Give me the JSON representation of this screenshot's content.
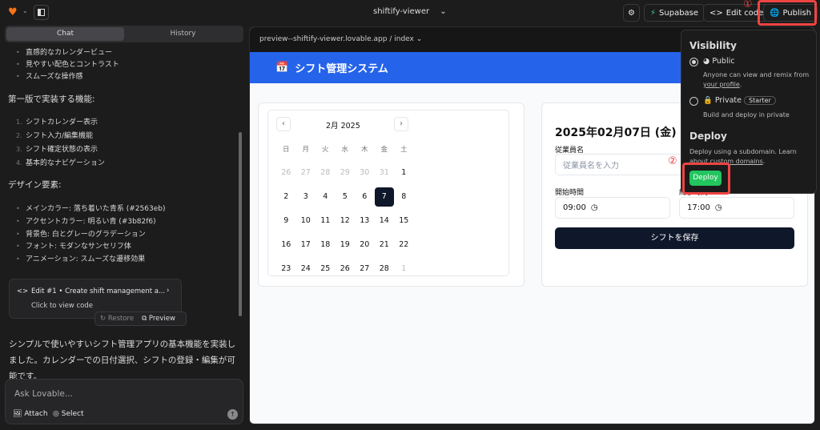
{
  "topbar": {
    "project": "shiftify-viewer",
    "supabase": "Supabase",
    "edit_code": "Edit code",
    "publish": "Publish",
    "annotation_1": "①",
    "annotation_2": "②"
  },
  "sidebar": {
    "tabs": [
      {
        "label": "Chat",
        "active": true
      },
      {
        "label": "History",
        "active": false
      }
    ],
    "bullets1": [
      "直感的なカレンダービュー",
      "見やすい配色とコントラスト",
      "スムーズな操作感"
    ],
    "heading_features": "第一版で実装する機能:",
    "features": [
      "シフトカレンダー表示",
      "シフト入力/編集機能",
      "シフト確定状態の表示",
      "基本的なナビゲーション"
    ],
    "heading_design": "デザイン要素:",
    "design": [
      "メインカラー: 落ち着いた青系 (#2563eb)",
      "アクセントカラー: 明るい青 (#3b82f6)",
      "背景色: 白とグレーのグラデーション",
      "フォント: モダンなサンセリフ体",
      "アニメーション: スムーズな遷移効果"
    ],
    "edit_card": {
      "title": "Edit #1 • Create shift management a...",
      "subtitle": "Click to view code",
      "restore": "Restore",
      "preview": "Preview"
    },
    "message": "シンプルで使いやすいシフト管理アプリの基本機能を実装しました。カレンダーでの日付選択、シフトの登録・編集が可能です。",
    "input_placeholder": "Ask Lovable...",
    "attach": "Attach",
    "select": "Select"
  },
  "preview": {
    "url": "preview--shiftify-viewer.lovable.app / index",
    "app_title": "シフト管理システム",
    "calendar": {
      "month": "2月 2025",
      "weekdays": [
        "日",
        "月",
        "火",
        "水",
        "木",
        "金",
        "土"
      ],
      "days": [
        [
          "26",
          "27",
          "28",
          "29",
          "30",
          "31",
          "1"
        ],
        [
          "2",
          "3",
          "4",
          "5",
          "6",
          "7",
          "8"
        ],
        [
          "9",
          "10",
          "11",
          "12",
          "13",
          "14",
          "15"
        ],
        [
          "16",
          "17",
          "18",
          "19",
          "20",
          "21",
          "22"
        ],
        [
          "23",
          "24",
          "25",
          "26",
          "27",
          "28",
          "1"
        ]
      ],
      "selected": "7"
    },
    "form": {
      "date_title": "2025年02月07日 (金)",
      "employee_label": "従業員名",
      "employee_placeholder": "従業員名を入力",
      "start_label": "開始時間",
      "start_value": "09:00",
      "end_label": "終了時間",
      "end_value": "17:00",
      "save": "シフトを保存"
    }
  },
  "publish_popover": {
    "visibility": "Visibility",
    "public": "Public",
    "public_desc": "Anyone can view and remix from",
    "your_profile": "your profile",
    "private": "Private",
    "starter": "Starter",
    "private_desc": "Build and deploy in private",
    "deploy_heading": "Deploy",
    "deploy_desc": "Deploy using a subdomain. Learn about",
    "custom_domains": "custom domains",
    "deploy_button": "Deploy",
    "selected": "public"
  },
  "colors": {
    "brand_blue": "#2563eb",
    "deploy_green": "#22c55e",
    "annotation_red": "#ef4444",
    "selected_day": "#0f172a"
  }
}
